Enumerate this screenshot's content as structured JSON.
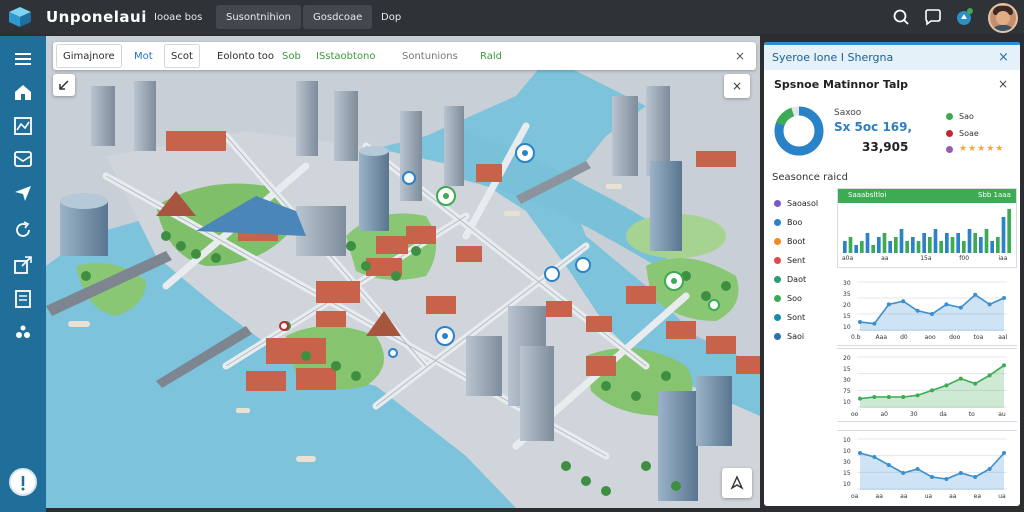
{
  "header": {
    "app_name": "Unponelaui",
    "menu": [
      "Iooae bos",
      "Susontnihion",
      "Gosdcoae",
      "Dop"
    ]
  },
  "sidebar": {
    "items": [
      "menu-icon",
      "home-icon",
      "map-icon",
      "layers-icon",
      "navigate-icon",
      "refresh-icon",
      "share-icon",
      "report-icon",
      "settings-icon"
    ]
  },
  "filters": {
    "items": [
      "Gimajnore",
      "Mot",
      "Scot",
      "Eolonto too",
      "Sob",
      "ISstaobtono",
      "Sontunions",
      "Rald"
    ],
    "close": "×"
  },
  "panel": {
    "title": "Syeroe Ione I Shergna",
    "close": "×",
    "subtitle": "Spsnoe Matinnor Talp",
    "subclose": "×",
    "kpi_label": "Saxoo",
    "kpi_values": "Sx 5oc 169,",
    "kpi_big": "33,905",
    "donut_percent": 0.82,
    "mini_legend": [
      {
        "label": "Sao",
        "color": "#3ea84a"
      },
      {
        "label": "Soae",
        "color": "#c1272d"
      },
      {
        "label": "",
        "color": "#9b59b6"
      }
    ],
    "rating": "★★★★★",
    "section_title": "Seasonce raicd",
    "legend": [
      {
        "label": "Saoasol",
        "color": "#7b57c7"
      },
      {
        "label": "Boo",
        "color": "#2a82c7"
      },
      {
        "label": "Boot",
        "color": "#f08a24"
      },
      {
        "label": "Sent",
        "color": "#e24a4a"
      },
      {
        "label": "Daot",
        "color": "#2a9d6e"
      },
      {
        "label": "Soo",
        "color": "#3cab53"
      },
      {
        "label": "Sont",
        "color": "#1a8ab0"
      },
      {
        "label": "Saoi",
        "color": "#2a6fb0"
      }
    ]
  },
  "chart_data": [
    {
      "type": "bar",
      "title": "Saaabsltloi",
      "title_right": "Sbb 1aaa",
      "values": [
        3,
        4,
        2,
        3,
        5,
        2,
        4,
        5,
        3,
        4,
        6,
        3,
        4,
        3,
        5,
        4,
        6,
        3,
        5,
        4,
        5,
        3,
        6,
        5,
        4,
        6,
        3,
        4,
        9,
        11
      ],
      "x_tick_labels": [
        "a0a",
        "aa",
        "15a",
        "f00",
        "iaa"
      ],
      "colors": [
        "#2a82c7",
        "#3cab53"
      ]
    },
    {
      "type": "area",
      "x": [
        0,
        1,
        2,
        3,
        4,
        5,
        6,
        7,
        8,
        9,
        10
      ],
      "y": [
        15,
        14,
        26,
        28,
        22,
        20,
        26,
        24,
        32,
        26,
        30
      ],
      "y_tick_labels": [
        "30",
        "35",
        "20",
        "15",
        "10"
      ],
      "x_tick_labels": [
        "0.b",
        "Aaa",
        "d0",
        "aoo",
        "doo",
        "toa",
        "aal"
      ],
      "ylim": [
        10,
        40
      ],
      "color": "#3b8fd0"
    },
    {
      "type": "area",
      "x": [
        0,
        1,
        2,
        3,
        4,
        5,
        6,
        7,
        8,
        9,
        10
      ],
      "y": [
        10,
        11,
        11,
        11,
        12,
        15,
        18,
        22,
        19,
        24,
        30
      ],
      "y_tick_labels": [
        "20",
        "15",
        "30",
        "75",
        "10"
      ],
      "x_tick_labels": [
        "oo",
        "a0",
        "30",
        "da",
        "to",
        "au"
      ],
      "ylim": [
        5,
        35
      ],
      "color": "#3cab53"
    },
    {
      "type": "area",
      "x": [
        0,
        1,
        2,
        3,
        4,
        5,
        6,
        7,
        8,
        9,
        10
      ],
      "y": [
        28,
        26,
        22,
        18,
        20,
        16,
        15,
        18,
        16,
        20,
        28
      ],
      "y_tick_labels": [
        "10",
        "10",
        "30",
        "15",
        "10"
      ],
      "x_tick_labels": [
        "oa",
        "aa",
        "aa",
        "ua",
        "aa",
        "ea",
        "ua"
      ],
      "ylim": [
        10,
        35
      ],
      "color": "#3b8fd0"
    }
  ]
}
